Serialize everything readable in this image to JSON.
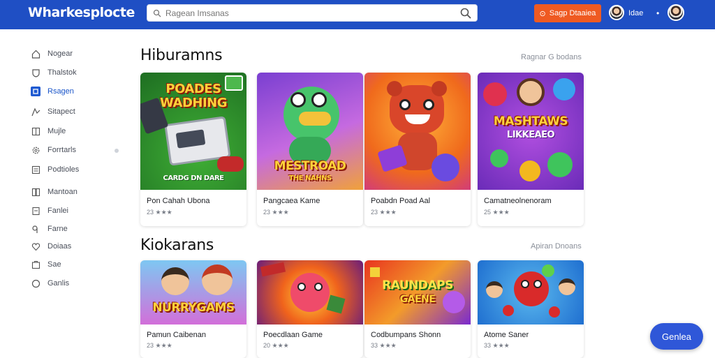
{
  "header": {
    "logo": "Wharkesplocte",
    "search_placeholder": "Ragean Imsanas",
    "cta_label": "Sagp Dtaaiea",
    "user_name": "Idae",
    "menu_glyph": "•",
    "colors": {
      "bar": "#1f4fc4",
      "cta": "#ef5a22"
    }
  },
  "sidebar": {
    "items": [
      {
        "label": "Nogear",
        "icon": "home-icon"
      },
      {
        "label": "Thalstok",
        "icon": "shield-icon"
      },
      {
        "label": "Rsagen",
        "icon": "square-icon"
      },
      {
        "label": "Sitapect",
        "icon": "chart-icon"
      },
      {
        "label": "Mujle",
        "icon": "grid-icon"
      },
      {
        "label": "Forrtarls",
        "icon": "gear-icon"
      },
      {
        "label": "Podtioles",
        "icon": "list-icon"
      },
      {
        "label": "Mantoan",
        "icon": "book-icon"
      },
      {
        "label": "Fanlei",
        "icon": "doc-icon"
      },
      {
        "label": "Farne",
        "icon": "tag-icon"
      },
      {
        "label": "Doiaas",
        "icon": "heart-icon"
      },
      {
        "label": "Sae",
        "icon": "bag-icon"
      },
      {
        "label": "Ganlis",
        "icon": "circle-icon"
      }
    ],
    "active_index": 2
  },
  "sections": [
    {
      "title": "Hiburamns",
      "link": "Ragnar G bodans",
      "cards": [
        {
          "title": "Pon Cahah Ubona",
          "rating": "23 ★★★",
          "art_text": "POADES WADHING",
          "art_sub": "CARDG DN DARE"
        },
        {
          "title": "Pangcaea Kame",
          "rating": "23 ★★★",
          "art_text": "MESTROAD",
          "art_sub": "THE NAHNS"
        },
        {
          "title": "Poabdn Poad Aal",
          "rating": "23 ★★★",
          "art_text": "",
          "art_sub": ""
        },
        {
          "title": "Camatneolnenoram",
          "rating": "25 ★★★",
          "art_text": "MASHTAWS",
          "art_sub": "LIKKEAEO"
        }
      ]
    },
    {
      "title": "Kiokarans",
      "link": "Apiran Dnoans",
      "cards": [
        {
          "title": "Pamun Caibenan",
          "rating": "23 ★★★",
          "art_text": "NURRYGAMS",
          "art_sub": ""
        },
        {
          "title": "Poecdlaan Game",
          "rating": "20 ★★★",
          "art_text": "",
          "art_sub": ""
        },
        {
          "title": "Codbumpans Shonn",
          "rating": "33 ★★★",
          "art_text": "RAUNDAPS",
          "art_sub": "GAENE"
        },
        {
          "title": "Atome Saner",
          "rating": "33 ★★★",
          "art_text": "",
          "art_sub": ""
        }
      ]
    }
  ],
  "fab_label": "Genlea"
}
